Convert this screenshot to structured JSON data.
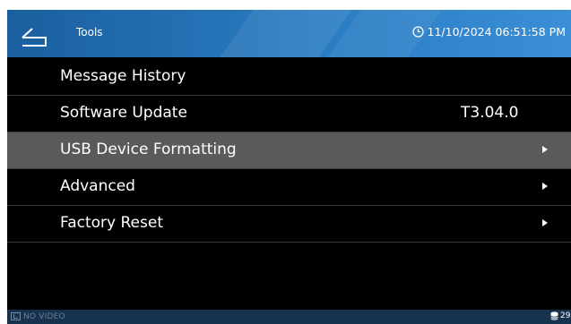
{
  "header": {
    "title": "Tools",
    "datetime": "11/10/2024 06:51:58 PM",
    "icons": {
      "back": "back-arrow-icon",
      "clock": "clock-icon"
    }
  },
  "menu": {
    "items": [
      {
        "label": "Message History",
        "value": "",
        "has_arrow": false,
        "selected": false
      },
      {
        "label": "Software Update",
        "value": "T3.04.0",
        "has_arrow": false,
        "selected": false
      },
      {
        "label": "USB Device Formatting",
        "value": "",
        "has_arrow": true,
        "selected": true
      },
      {
        "label": "Advanced",
        "value": "",
        "has_arrow": true,
        "selected": false
      },
      {
        "label": "Factory Reset",
        "value": "",
        "has_arrow": true,
        "selected": false
      }
    ]
  },
  "footer": {
    "video_status": "NO VIDEO",
    "storage_text": "29",
    "icons": {
      "video": "video-icon",
      "storage": "storage-icon"
    }
  },
  "colors": {
    "header_start": "#1a5f9e",
    "header_end": "#3a8fd6",
    "background": "#000000",
    "selected_row": "#5a5a5a",
    "footer": "#16324f"
  }
}
